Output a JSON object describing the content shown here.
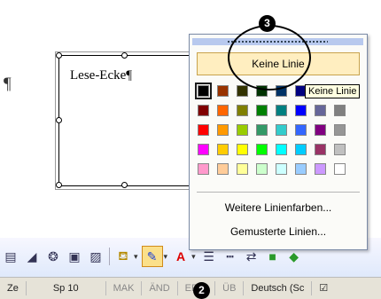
{
  "document": {
    "pilcrow": "¶",
    "textbox_text": "Lese-Ecke¶"
  },
  "line_menu": {
    "no_line_label": "Keine Linie",
    "more_colors_label": "Weitere Linienfarben...",
    "pattern_label": "Gemusterte Linien...",
    "colors": [
      [
        "#000000",
        "#993300",
        "#333300",
        "#003300",
        "#003366",
        "#000080",
        "#333399",
        "#333333"
      ],
      [
        "#800000",
        "#FF6600",
        "#808000",
        "#008000",
        "#008080",
        "#0000FF",
        "#666699",
        "#808080"
      ],
      [
        "#FF0000",
        "#FF9900",
        "#99CC00",
        "#339966",
        "#33CCCC",
        "#3366FF",
        "#800080",
        "#969696"
      ],
      [
        "#FF00FF",
        "#FFCC00",
        "#FFFF00",
        "#00FF00",
        "#00FFFF",
        "#00CCFF",
        "#993366",
        "#C0C0C0"
      ],
      [
        "#FF99CC",
        "#FFCC99",
        "#FFFF99",
        "#CCFFCC",
        "#CCFFFF",
        "#99CCFF",
        "#CC99FF",
        "#FFFFFF"
      ]
    ]
  },
  "tooltip": "Keine Linie",
  "markers": {
    "three": "3",
    "two": "2"
  },
  "status_bar": {
    "ze": "Ze",
    "sp": "Sp 10",
    "mak": "MAK",
    "aend": "ÄND",
    "erw": "ERW",
    "ueb": "ÜB",
    "language": "Deutsch (Sc"
  }
}
